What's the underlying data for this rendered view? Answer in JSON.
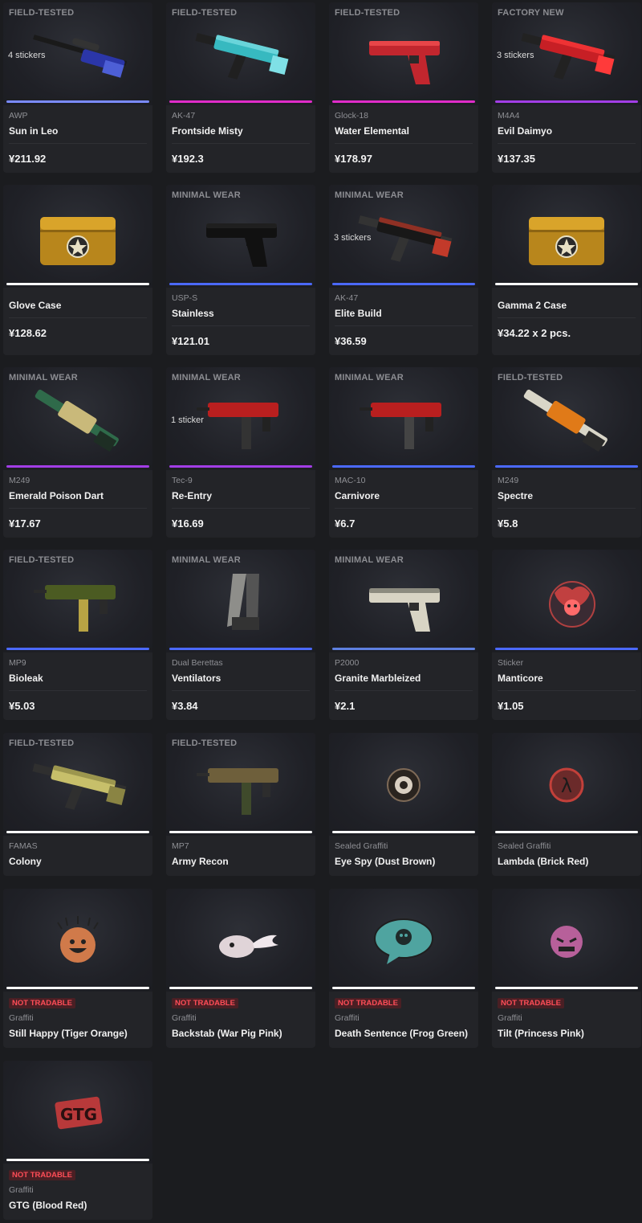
{
  "colors": {
    "rarity_covert": "#eb4b4b",
    "rarity_classified": "#d32ce6",
    "rarity_restricted": "#8847ff",
    "rarity_milspec": "#4b69ff",
    "rarity_industrial": "#5e98d9",
    "rarity_base": "#ffffff"
  },
  "items": [
    {
      "wear": "FIELD-TESTED",
      "stickers": "4 stickers",
      "type": "AWP",
      "name": "Sun in Leo",
      "price": "¥211.92",
      "rarity": "#7a8bff",
      "icon": "sniper-rifle-icon"
    },
    {
      "wear": "FIELD-TESTED",
      "stickers": "",
      "type": "AK-47",
      "name": "Frontside Misty",
      "price": "¥192.3",
      "rarity": "#e02cc9",
      "icon": "rifle-icon"
    },
    {
      "wear": "FIELD-TESTED",
      "stickers": "",
      "type": "Glock-18",
      "name": "Water Elemental",
      "price": "¥178.97",
      "rarity": "#e02cc9",
      "icon": "pistol-icon"
    },
    {
      "wear": "FACTORY NEW",
      "stickers": "3 stickers",
      "type": "M4A4",
      "name": "Evil Daimyo",
      "price": "¥137.35",
      "rarity": "#a23ee6",
      "icon": "rifle-icon"
    },
    {
      "wear": "",
      "stickers": "",
      "type": "",
      "name": "Glove Case",
      "price": "¥128.62",
      "rarity": "#ffffff",
      "icon": "case-icon"
    },
    {
      "wear": "MINIMAL WEAR",
      "stickers": "",
      "type": "USP-S",
      "name": "Stainless",
      "price": "¥121.01",
      "rarity": "#4b69ff",
      "icon": "pistol-icon"
    },
    {
      "wear": "MINIMAL WEAR",
      "stickers": "3 stickers",
      "type": "AK-47",
      "name": "Elite Build",
      "price": "¥36.59",
      "rarity": "#4b69ff",
      "icon": "rifle-icon"
    },
    {
      "wear": "",
      "stickers": "",
      "type": "",
      "name": "Gamma 2 Case",
      "price": "¥34.22 x 2 pcs.",
      "rarity": "#ffffff",
      "icon": "case-icon"
    },
    {
      "wear": "MINIMAL WEAR",
      "stickers": "",
      "type": "M249",
      "name": "Emerald Poison Dart",
      "price": "¥17.67",
      "rarity": "#a23ee6",
      "icon": "machine-gun-icon"
    },
    {
      "wear": "MINIMAL WEAR",
      "stickers": "1 sticker",
      "type": "Tec-9",
      "name": "Re-Entry",
      "price": "¥16.69",
      "rarity": "#a23ee6",
      "icon": "smg-icon"
    },
    {
      "wear": "MINIMAL WEAR",
      "stickers": "",
      "type": "MAC-10",
      "name": "Carnivore",
      "price": "¥6.7",
      "rarity": "#4b69ff",
      "icon": "smg-icon"
    },
    {
      "wear": "FIELD-TESTED",
      "stickers": "",
      "type": "M249",
      "name": "Spectre",
      "price": "¥5.8",
      "rarity": "#4b69ff",
      "icon": "machine-gun-icon"
    },
    {
      "wear": "FIELD-TESTED",
      "stickers": "",
      "type": "MP9",
      "name": "Bioleak",
      "price": "¥5.03",
      "rarity": "#4b69ff",
      "icon": "smg-icon"
    },
    {
      "wear": "MINIMAL WEAR",
      "stickers": "",
      "type": "Dual Berettas",
      "name": "Ventilators",
      "price": "¥3.84",
      "rarity": "#4b69ff",
      "icon": "dual-pistols-icon"
    },
    {
      "wear": "MINIMAL WEAR",
      "stickers": "",
      "type": "P2000",
      "name": "Granite Marbleized",
      "price": "¥2.1",
      "rarity": "#5e80e0",
      "icon": "pistol-icon"
    },
    {
      "wear": "",
      "stickers": "",
      "type": "Sticker",
      "name": "Manticore",
      "price": "¥1.05",
      "rarity": "#4b69ff",
      "icon": "sticker-icon"
    },
    {
      "wear": "FIELD-TESTED",
      "stickers": "",
      "type": "FAMAS",
      "name": "Colony",
      "price": "",
      "rarity": "#ffffff",
      "icon": "rifle-icon"
    },
    {
      "wear": "FIELD-TESTED",
      "stickers": "",
      "type": "MP7",
      "name": "Army Recon",
      "price": "",
      "rarity": "#ffffff",
      "icon": "smg-icon"
    },
    {
      "wear": "",
      "stickers": "",
      "type": "Sealed Graffiti",
      "name": "Eye Spy (Dust Brown)",
      "price": "",
      "rarity": "#ffffff",
      "icon": "graffiti-icon"
    },
    {
      "wear": "",
      "stickers": "",
      "type": "Sealed Graffiti",
      "name": "Lambda (Brick Red)",
      "price": "",
      "rarity": "#ffffff",
      "icon": "graffiti-icon"
    },
    {
      "wear": "",
      "stickers": "",
      "badge": "NOT TRADABLE",
      "type": "Graffiti",
      "name": "Still Happy (Tiger Orange)",
      "price": "",
      "rarity": "#ffffff",
      "icon": "graffiti-icon"
    },
    {
      "wear": "",
      "stickers": "",
      "badge": "NOT TRADABLE",
      "type": "Graffiti",
      "name": "Backstab (War Pig Pink)",
      "price": "",
      "rarity": "#ffffff",
      "icon": "graffiti-icon"
    },
    {
      "wear": "",
      "stickers": "",
      "badge": "NOT TRADABLE",
      "type": "Graffiti",
      "name": "Death Sentence (Frog Green)",
      "price": "",
      "rarity": "#ffffff",
      "icon": "graffiti-icon"
    },
    {
      "wear": "",
      "stickers": "",
      "badge": "NOT TRADABLE",
      "type": "Graffiti",
      "name": "Tilt (Princess Pink)",
      "price": "",
      "rarity": "#ffffff",
      "icon": "graffiti-icon"
    },
    {
      "wear": "",
      "stickers": "",
      "badge": "NOT TRADABLE",
      "type": "Graffiti",
      "name": "GTG (Blood Red)",
      "price": "",
      "rarity": "#ffffff",
      "icon": "graffiti-icon"
    }
  ]
}
